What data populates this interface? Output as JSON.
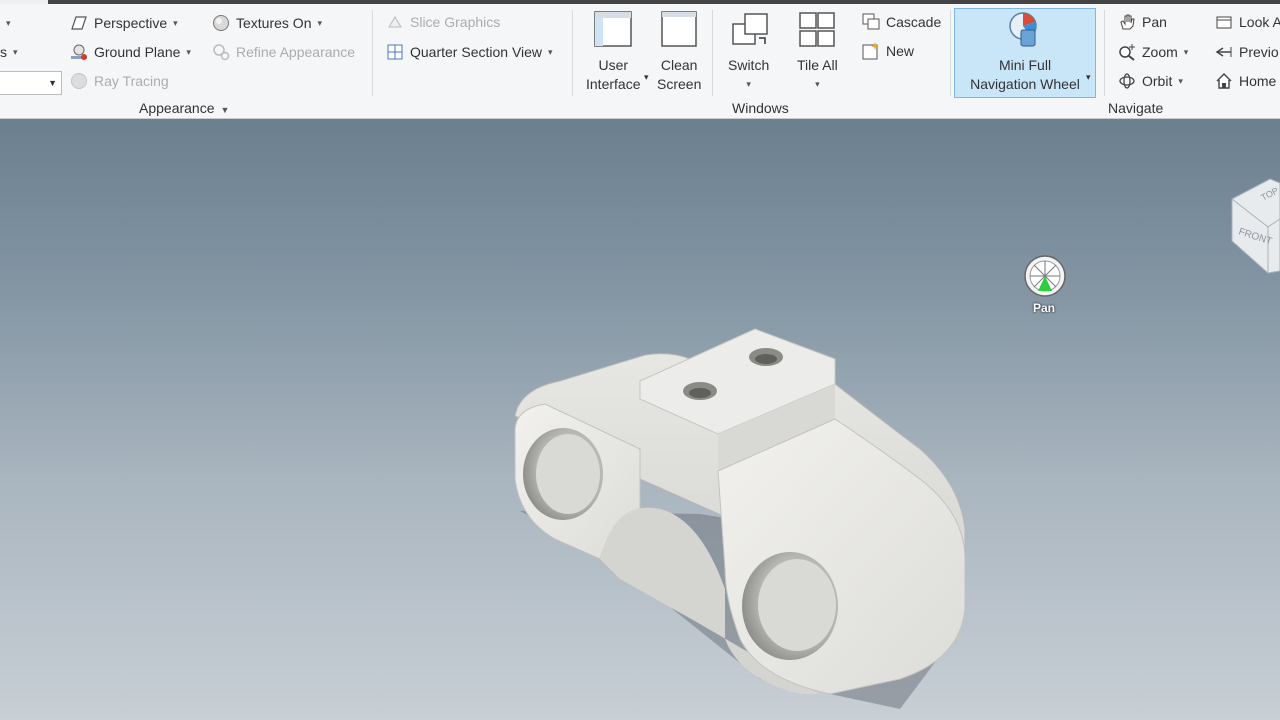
{
  "ribbon": {
    "appearance": {
      "perspective": "Perspective",
      "textures_on": "Textures On",
      "ground_plane": "Ground Plane",
      "refine_appearance": "Refine Appearance",
      "ray_tracing": "Ray Tracing",
      "panel_title": "Appearance"
    },
    "section": {
      "slice_graphics": "Slice Graphics",
      "quarter_section_view": "Quarter Section View"
    },
    "windows": {
      "user_interface_1": "User",
      "user_interface_2": "Interface",
      "clean_screen_1": "Clean",
      "clean_screen_2": "Screen",
      "switch": "Switch",
      "tile_all": "Tile All",
      "cascade": "Cascade",
      "new": "New",
      "panel_title": "Windows"
    },
    "navigate": {
      "mini_full_1": "Mini Full",
      "mini_full_2": "Navigation Wheel",
      "pan": "Pan",
      "zoom": "Zoom",
      "orbit": "Orbit",
      "look_at": "Look A",
      "previous": "Previo",
      "home": "Home",
      "panel_title": "Navigate"
    }
  },
  "viewport": {
    "wheel_label": "Pan",
    "viewcube_top": "TOP",
    "viewcube_front": "FRONT"
  },
  "colors": {
    "active_button": "#c9e5f8",
    "wheel_green": "#2ecc40"
  }
}
